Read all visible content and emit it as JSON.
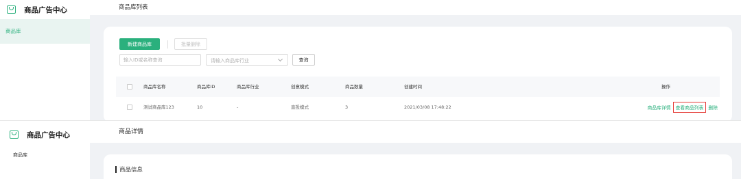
{
  "app": {
    "brand": "商品广告中心",
    "brand_icon": "shopping-bag-icon",
    "accent_color": "#2ab07d",
    "highlight_color": "#e53935"
  },
  "top_panel": {
    "page_title": "商品库列表",
    "sidebar": {
      "items": [
        {
          "label": "商品库",
          "active": true
        }
      ]
    },
    "toolbar": {
      "new_label": "新建商品库",
      "batch_delete_label": "批量删除"
    },
    "filters": {
      "search_placeholder": "输入ID或名称查询",
      "industry_placeholder": "请输入商品库行业",
      "query_label": "查询"
    },
    "table": {
      "headers": {
        "name": "商品库名称",
        "id": "商品库ID",
        "industry": "商品库行业",
        "mode": "创意模式",
        "count": "商品数量",
        "created": "创建时间",
        "actions": "操作"
      },
      "rows": [
        {
          "name": "测试商品库123",
          "id": "10",
          "industry": "-",
          "mode": "直投模式",
          "count": "3",
          "created": "2021/03/08 17:48:22",
          "actions": {
            "detail": "商品库详情",
            "view_list": "查看商品列表",
            "delete": "删除"
          }
        }
      ]
    }
  },
  "bottom_panel": {
    "page_title": "商品详情",
    "sidebar": {
      "items": [
        {
          "label": "商品库"
        }
      ]
    },
    "section_title": "商品信息"
  }
}
